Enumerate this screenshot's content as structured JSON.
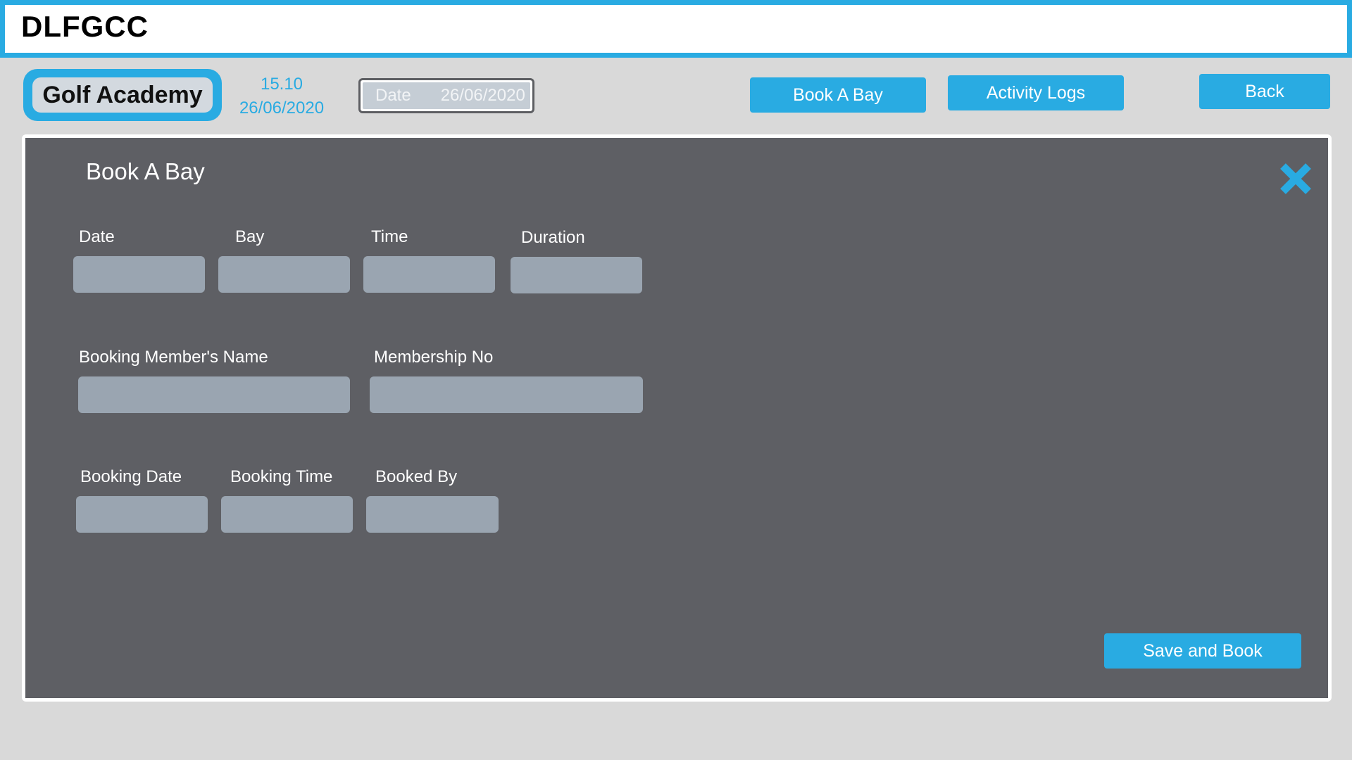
{
  "app": {
    "title": "DLFGCC"
  },
  "header": {
    "section": "Golf Academy",
    "clock_time": "15.10",
    "clock_date": "26/06/2020",
    "date_box": {
      "label": "Date",
      "value": "26/06/2020"
    },
    "buttons": {
      "book_bay": "Book A Bay",
      "activity_logs": "Activity Logs",
      "back": "Back"
    }
  },
  "form": {
    "title": "Book A Bay",
    "fields": {
      "date": {
        "label": "Date",
        "value": ""
      },
      "bay": {
        "label": "Bay",
        "value": ""
      },
      "time": {
        "label": "Time",
        "value": ""
      },
      "duration": {
        "label": "Duration",
        "value": ""
      },
      "member_name": {
        "label": "Booking Member's Name",
        "value": ""
      },
      "membership_no": {
        "label": "Membership No",
        "value": ""
      },
      "booking_date": {
        "label": "Booking Date",
        "value": ""
      },
      "booking_time": {
        "label": "Booking Time",
        "value": ""
      },
      "booked_by": {
        "label": "Booked By",
        "value": ""
      }
    },
    "save_label": "Save and Book",
    "close_icon": "close-x-icon"
  },
  "colors": {
    "accent": "#29abe2",
    "panel": "#5e5f64",
    "input": "#9aa5b1",
    "background": "#d9d9d9"
  }
}
